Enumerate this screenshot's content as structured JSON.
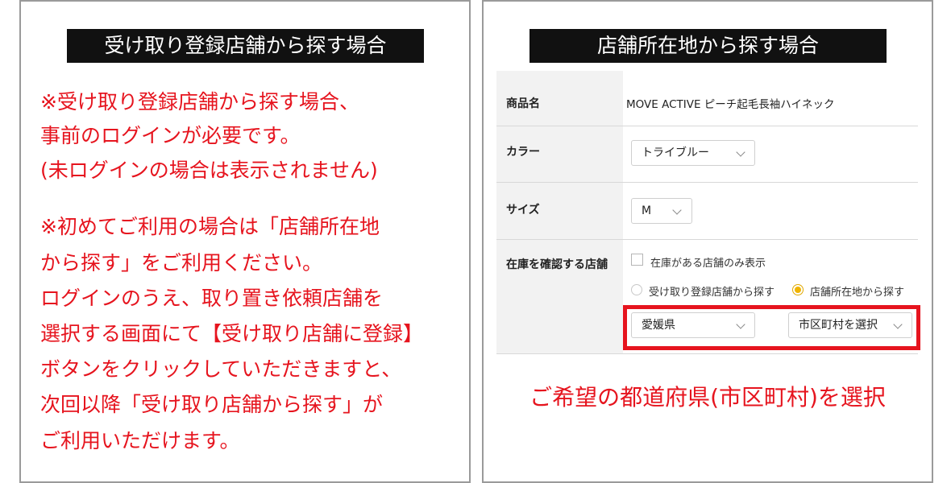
{
  "left_panel": {
    "title": "受け取り登録店舗から探す場合",
    "notes": [
      "※受け取り登録店舗から探す場合、",
      "事前のログインが必要です。",
      "(未ログインの場合は表示されません)",
      "※初めてご利用の場合は「店舗所在地",
      "から探す」をご利用ください。",
      "ログインのうえ、取り置き依頼店舗を",
      "選択する画面にて【受け取り店舗に登録】",
      "ボタンをクリックしていただきますと、",
      "次回以降「受け取り店舗から探す」が",
      "ご利用いただけます。"
    ]
  },
  "right_panel": {
    "title": "店舗所在地から探す場合",
    "form": {
      "product_label": "商品名",
      "product_value": "MOVE ACTIVE ピーチ起毛長袖ハイネック",
      "color_label": "カラー",
      "color_value": "トライブルー",
      "size_label": "サイズ",
      "size_value": "M",
      "stock_label": "在庫を確認する店舗",
      "only_in_stock_label": "在庫がある店舗のみ表示",
      "radio_registered_label": "受け取り登録店舗から探す",
      "radio_location_label": "店舗所在地から探す",
      "prefecture_value": "愛媛県",
      "city_value": "市区町村を選択"
    },
    "caption": "ご希望の都道府県(市区町村)を選択"
  },
  "colors": {
    "accent_red": "#e6141e",
    "title_bg": "#111111",
    "radio_selected": "#f0b400"
  }
}
